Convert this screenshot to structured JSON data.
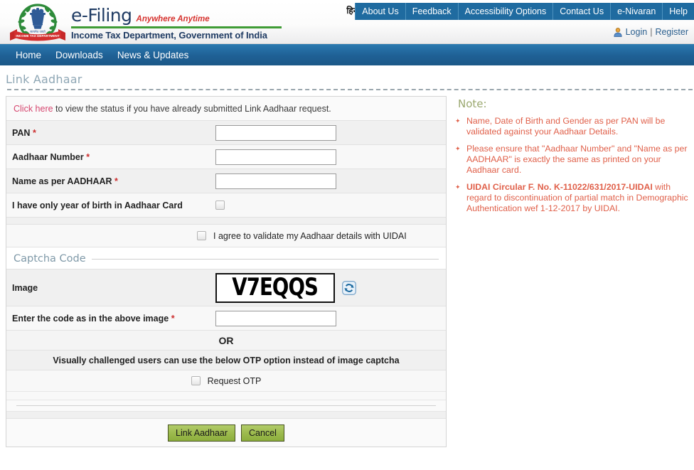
{
  "header": {
    "brand_name": "e-Filing",
    "tagline": "Anywhere Anytime",
    "department": "Income Tax Department, Government of India",
    "emblem_alt": "income-tax-department-emblem",
    "emblem_banner": "INCOME TAX DEPARTMENT",
    "hindi_label": "हिन्दी",
    "top_nav": [
      {
        "label": "About Us"
      },
      {
        "label": "Feedback"
      },
      {
        "label": "Accessibility Options"
      },
      {
        "label": "Contact Us"
      },
      {
        "label": "e-Nivaran"
      },
      {
        "label": "Help"
      }
    ],
    "login_label": "Login",
    "separator": "|",
    "register_label": "Register"
  },
  "main_nav": [
    {
      "label": "Home"
    },
    {
      "label": "Downloads"
    },
    {
      "label": "News & Updates"
    }
  ],
  "page": {
    "title": "Link Aadhaar"
  },
  "form": {
    "notice_link": "Click here",
    "notice_text": " to view the status if you have already submitted Link Aadhaar request.",
    "fields": [
      {
        "label": "PAN ",
        "required": "*",
        "value": "",
        "placeholder": ""
      },
      {
        "label": "Aadhaar Number ",
        "required": "*",
        "value": "",
        "placeholder": ""
      },
      {
        "label": "Name as per AADHAAR ",
        "required": "*",
        "value": "",
        "placeholder": ""
      }
    ],
    "year_of_birth_label": "I have only year of birth in Aadhaar Card",
    "year_of_birth_checked": false,
    "agree_label": "I agree to validate my Aadhaar details with UIDAI",
    "agree_checked": false,
    "captcha_section_title": "Captcha Code",
    "image_label": "Image",
    "captcha_value": "V7EQQS",
    "refresh_icon": "refresh-icon",
    "captcha_input_label": "Enter the code as in the above image ",
    "captcha_input_required": "*",
    "captcha_input_value": "",
    "or_label": "OR",
    "visually_challenged_label": "Visually challenged users can use the below OTP option instead of image captcha",
    "request_otp_label": "Request OTP",
    "request_otp_checked": false,
    "submit_label": "Link Aadhaar",
    "cancel_label": "Cancel"
  },
  "note": {
    "title": "Note:",
    "items": [
      {
        "text": "Name, Date of Birth and Gender as per PAN will be validated against your Aadhaar Details.",
        "bold_prefix": ""
      },
      {
        "text": "Please ensure that \"Aadhaar Number\" and \"Name as per AADHAAR\" is exactly the same as printed on your Aadhaar card.",
        "bold_prefix": ""
      },
      {
        "text": " with regard to discontinuation of partial match in Demographic Authentication wef 1-12-2017 by UIDAI.",
        "bold_prefix": "UIDAI Circular F. No. K-11022/631/2017-UIDAI"
      }
    ]
  },
  "colors": {
    "nav_blue": "#1f6095",
    "top_nav_blue": "#1f6ba0",
    "brand_navy": "#1f3b63",
    "tagline_red": "#d6322e",
    "rule_green": "#3f9c35",
    "note_red": "#e0604a",
    "link_pink": "#d6456e",
    "button_green": "#9dbb4e",
    "title_gray_blue": "#8fa7b5"
  }
}
